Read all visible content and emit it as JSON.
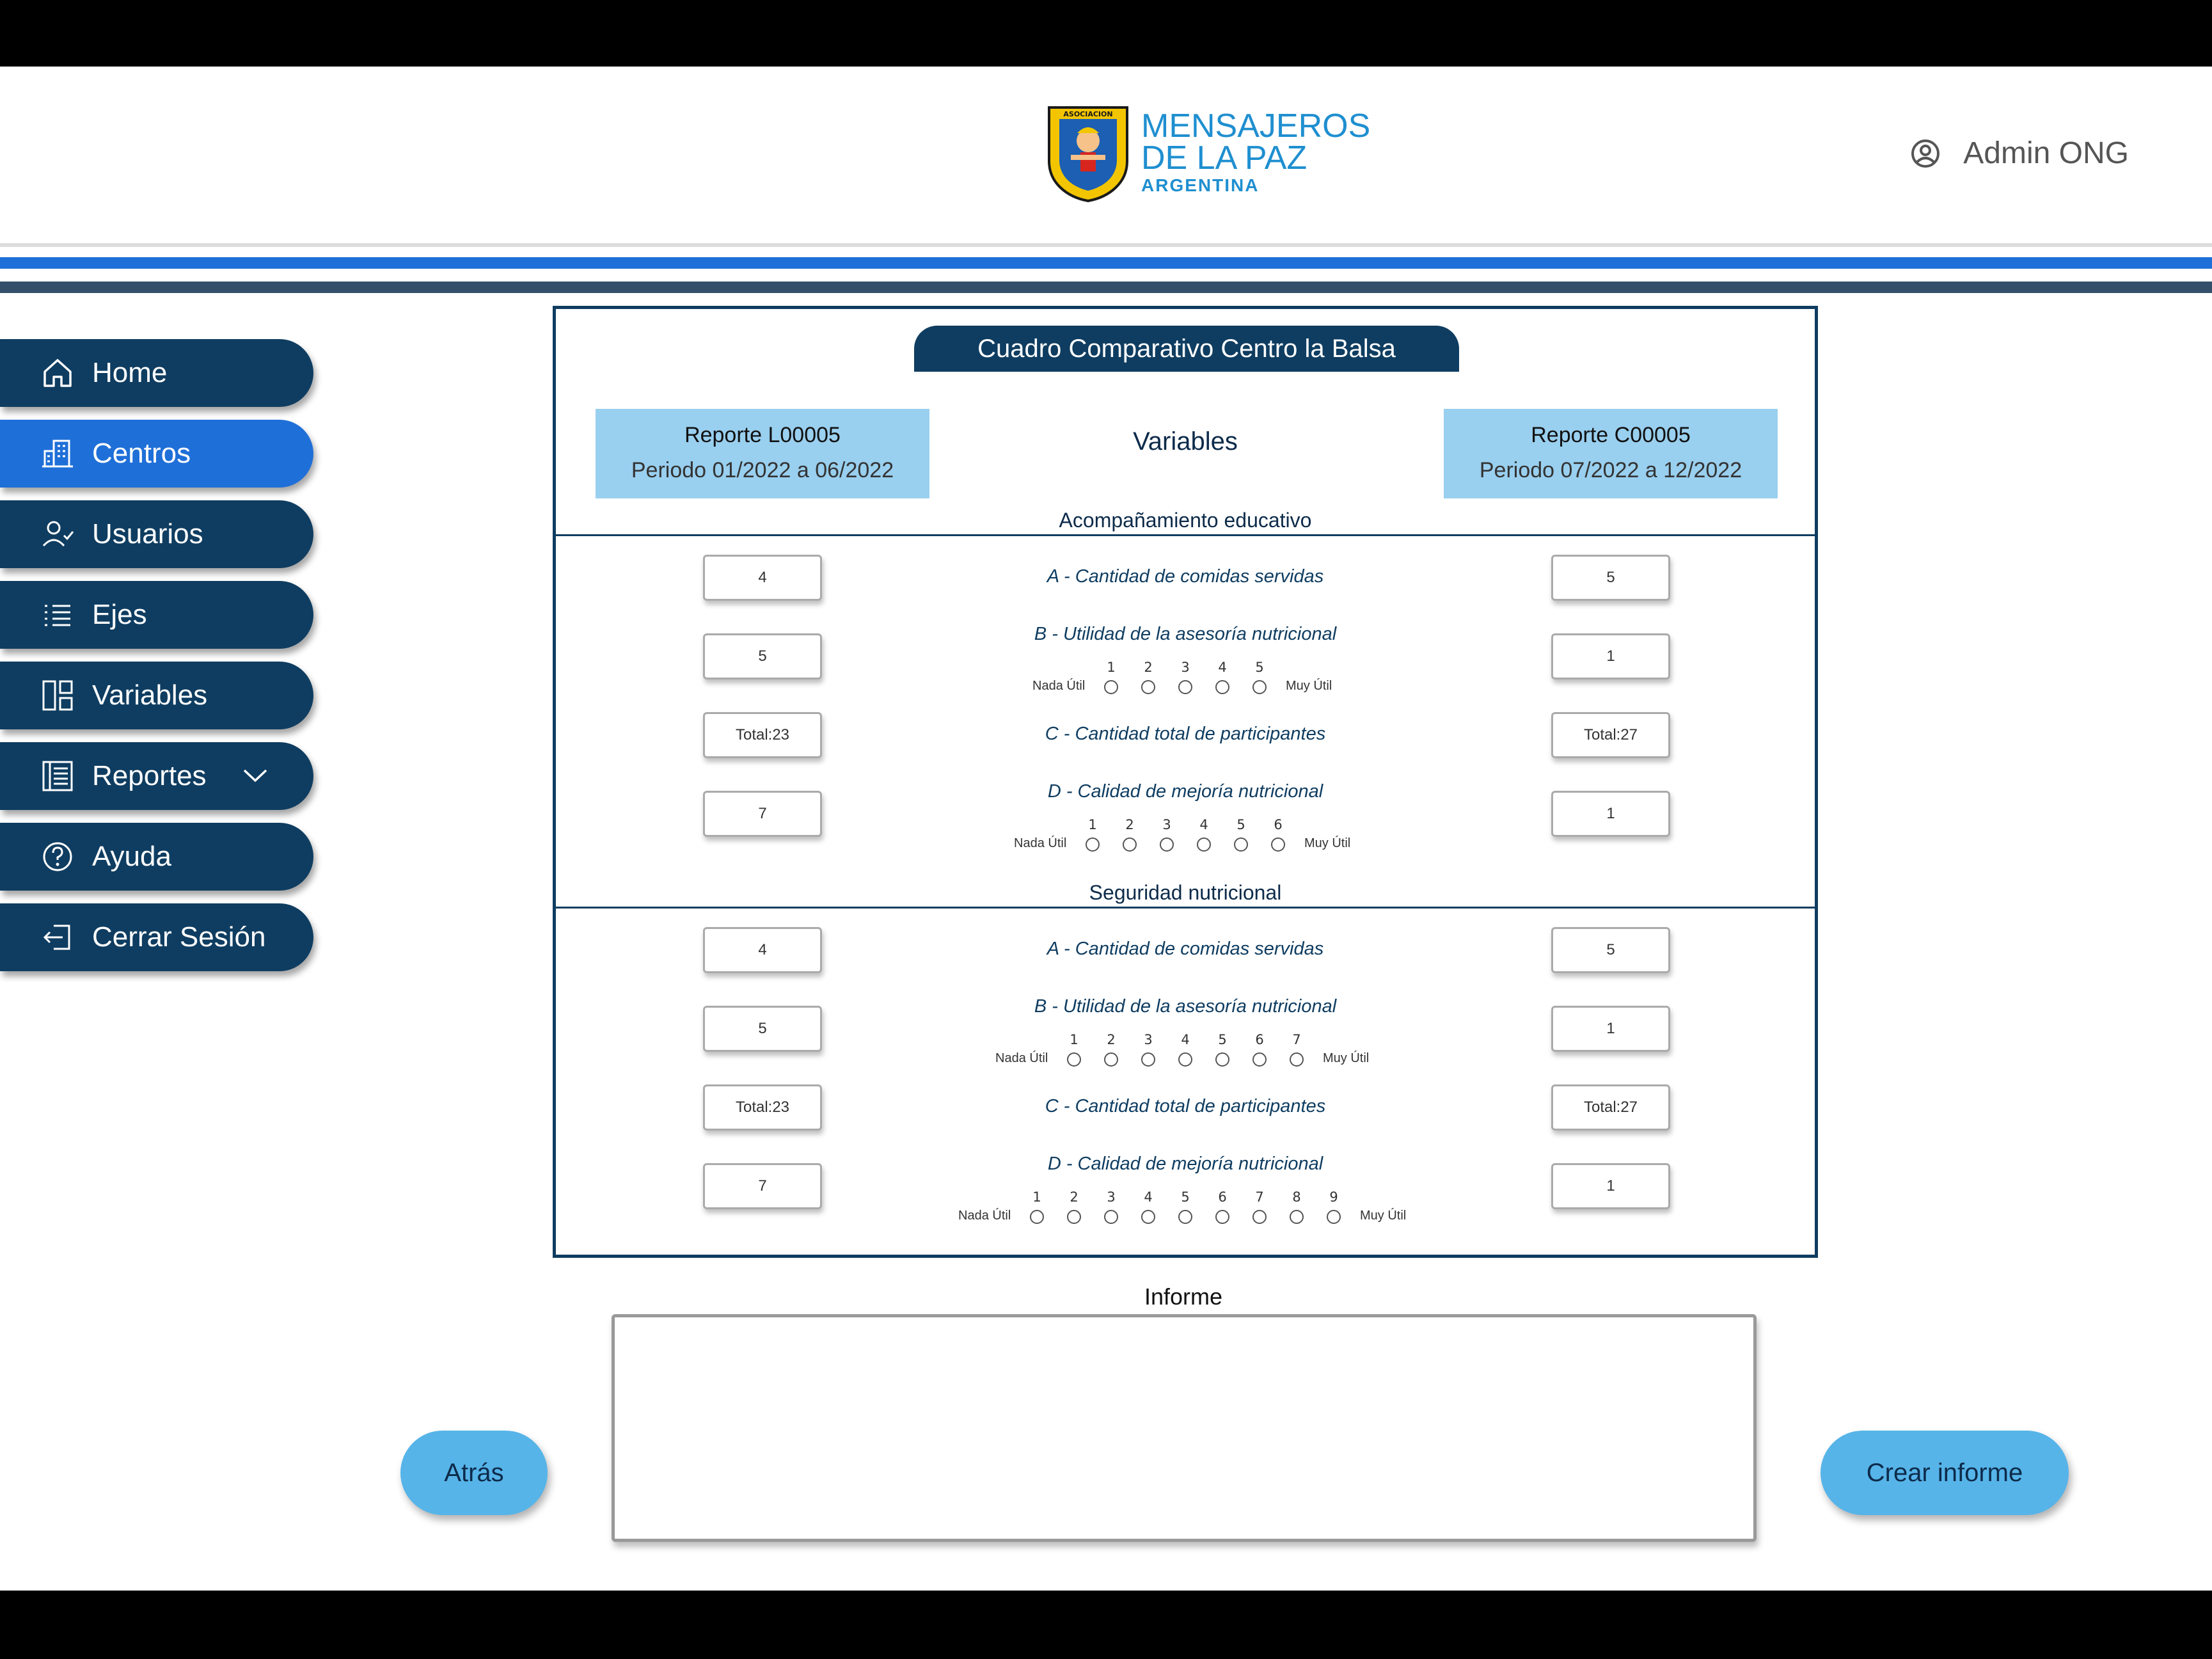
{
  "brand": {
    "line1": "MENSAJEROS",
    "line2": "DE LA PAZ",
    "line3": "ARGENTINA",
    "shield_text": "ASOCIACION MENSAJEROS DE LA PAZ",
    "colors": {
      "primary": "#1f8fd0",
      "shield": "#f2c500",
      "shield_inner": "#1c5fb3"
    }
  },
  "user": {
    "name": "Admin ONG",
    "icon": "user-circle-icon"
  },
  "colors": {
    "nav_dark": "#0f3d61",
    "nav_active": "#1f6fd8",
    "report_box": "#99cfef",
    "button": "#56b4e9"
  },
  "sidebar": {
    "items": [
      {
        "label": "Home",
        "icon": "home-icon"
      },
      {
        "label": "Centros",
        "icon": "building-icon",
        "active": true
      },
      {
        "label": "Usuarios",
        "icon": "user-check-icon"
      },
      {
        "label": "Ejes",
        "icon": "list-icon"
      },
      {
        "label": "Variables",
        "icon": "layout-icon"
      },
      {
        "label": "Reportes",
        "icon": "report-icon",
        "has_dropdown": true
      },
      {
        "label": "Ayuda",
        "icon": "help-icon"
      },
      {
        "label": "Cerrar Sesión",
        "icon": "logout-icon"
      }
    ]
  },
  "panel": {
    "title": "Cuadro Comparativo Centro la Balsa",
    "left_report": {
      "title": "Reporte L00005",
      "period": "Periodo 01/2022 a 06/2022"
    },
    "right_report": {
      "title": "Reporte C00005",
      "period": "Periodo 07/2022 a 12/2022"
    },
    "variables_heading": "Variables",
    "scale_low": "Nada Útil",
    "scale_high": "Muy Útil",
    "sections": [
      {
        "title": "Acompañamiento educativo",
        "rows": [
          {
            "label": "A - Cantidad de comidas servidas",
            "left": "4",
            "right": "5"
          },
          {
            "label": "B - Utilidad de la asesoría nutricional",
            "left": "5",
            "right": "1",
            "scale": [
              "1",
              "2",
              "3",
              "4",
              "5"
            ]
          },
          {
            "label": "C - Cantidad total de participantes",
            "left": "Total:23",
            "right": "Total:27"
          },
          {
            "label": "D - Calidad de mejoría nutricional",
            "left": "7",
            "right": "1",
            "scale": [
              "1",
              "2",
              "3",
              "4",
              "5",
              "6"
            ]
          }
        ]
      },
      {
        "title": "Seguridad nutricional",
        "rows": [
          {
            "label": "A - Cantidad de comidas servidas",
            "left": "4",
            "right": "5"
          },
          {
            "label": "B - Utilidad de la asesoría nutricional",
            "left": "5",
            "right": "1",
            "scale": [
              "1",
              "2",
              "3",
              "4",
              "5",
              "6",
              "7"
            ]
          },
          {
            "label": "C - Cantidad total de participantes",
            "left": "Total:23",
            "right": "Total:27"
          },
          {
            "label": "D - Calidad de mejoría nutricional",
            "left": "7",
            "right": "1",
            "scale": [
              "1",
              "2",
              "3",
              "4",
              "5",
              "6",
              "7",
              "8",
              "9"
            ]
          }
        ]
      }
    ]
  },
  "informe": {
    "label": "Informe",
    "value": ""
  },
  "buttons": {
    "back": "Atrás",
    "create": "Crear informe"
  }
}
